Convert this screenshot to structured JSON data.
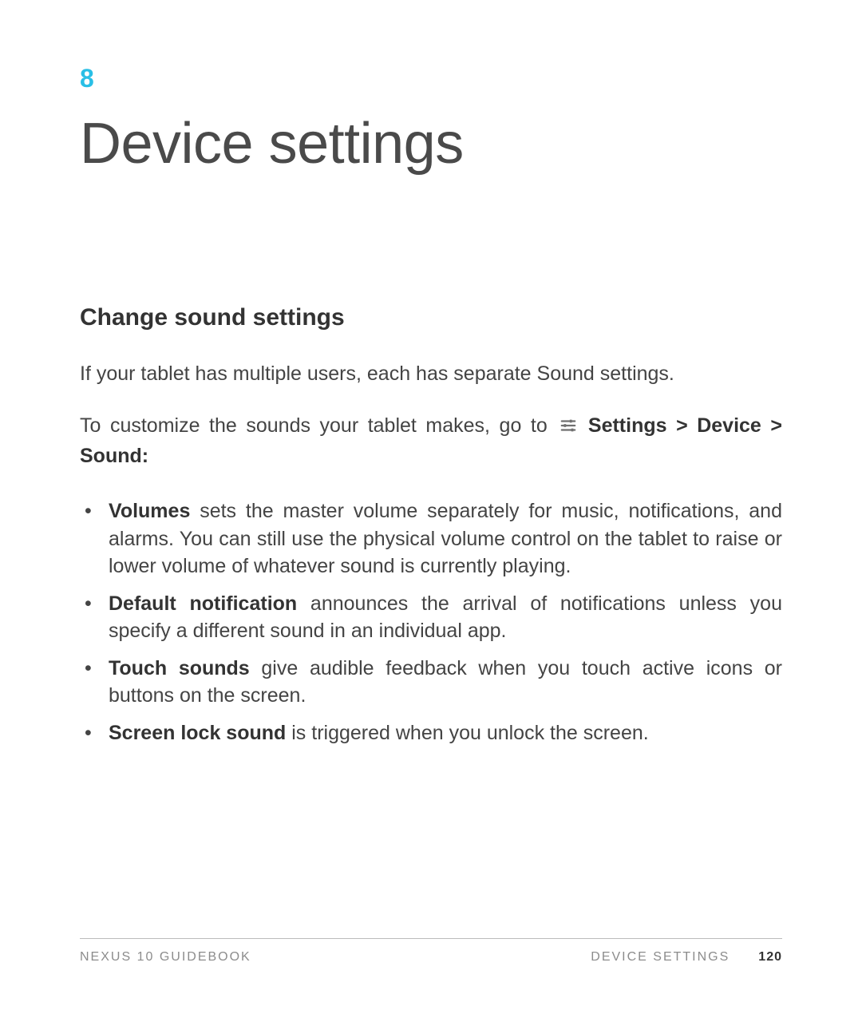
{
  "chapter": {
    "number": "8",
    "title": "Device settings"
  },
  "section": {
    "title": "Change sound settings",
    "paragraph1": "If your tablet has multiple users, each has separate Sound settings.",
    "paragraph2_pre": "To customize the sounds your tablet makes, go to ",
    "navpath": "Settings > Device > Sound:",
    "bullets": [
      {
        "bold": "Volumes",
        "text": " sets the master volume separately for music, notifications, and alarms. You can still use the physical volume control on the tablet to raise or lower volume of whatever sound is currently playing."
      },
      {
        "bold": "Default notification",
        "text": " announces the arrival of notifications unless you specify a different sound in an individual app."
      },
      {
        "bold": "Touch sounds",
        "text": " give audible feedback when you touch active icons or buttons on the screen."
      },
      {
        "bold": "Screen lock sound",
        "text": " is triggered when you unlock the screen."
      }
    ]
  },
  "footer": {
    "left": "NEXUS 10 GUIDEBOOK",
    "center": "DEVICE SETTINGS",
    "page": "120"
  },
  "icons": {
    "settings": "sliders-icon"
  }
}
